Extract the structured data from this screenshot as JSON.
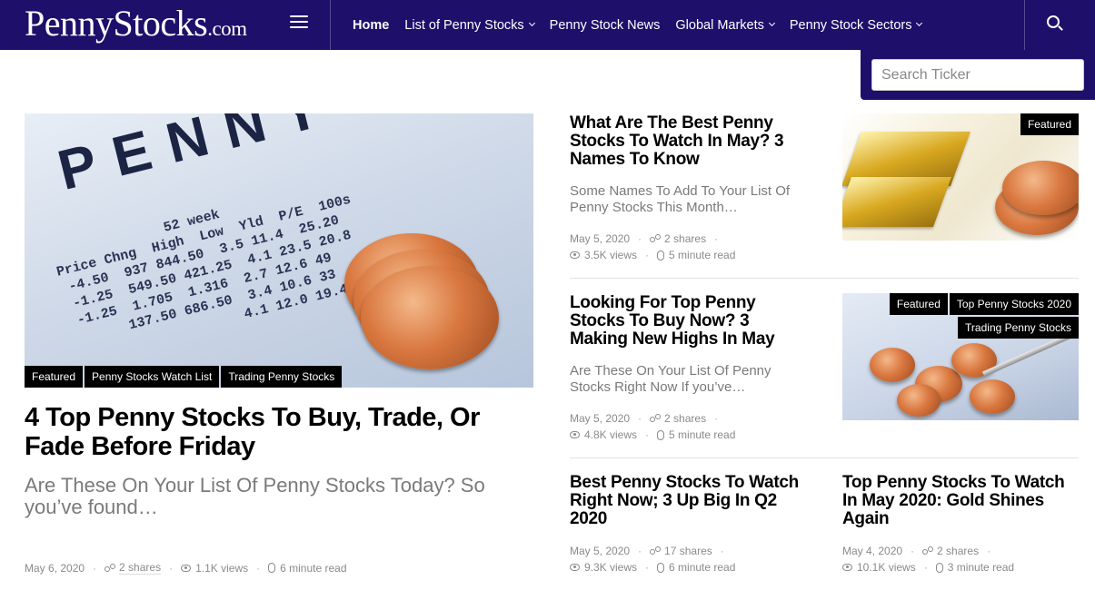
{
  "header": {
    "logo_main": "PennyStocks",
    "logo_domain": ".com",
    "nav": [
      "Home",
      "List of Penny Stocks",
      "Penny Stock News",
      "Global Markets",
      "Penny Stock Sectors"
    ],
    "search_placeholder": "Search Ticker",
    "colors": {
      "bar": "#1e0f6b",
      "text": "#ffffff"
    }
  },
  "hero": {
    "image_text": "PENNY STOCKS",
    "tags": [
      "Featured",
      "Penny Stocks Watch List",
      "Trading Penny Stocks"
    ],
    "title": "4 Top Penny Stocks To Buy, Trade, Or Fade Before Friday",
    "excerpt": "Are These On Your List Of Penny Stocks Today? So you’ve found…",
    "date": "May 6, 2020",
    "shares": "2 shares",
    "views": "1.1K views",
    "read": "6 minute read"
  },
  "cards": [
    {
      "title": "What Are The Best Penny Stocks To Watch In May? 3 Names To Know",
      "excerpt": "Some Names To Add To Your List Of Penny Stocks This Month…",
      "date": "May 5, 2020",
      "shares": "2 shares",
      "views": "3.5K views",
      "read": "5 minute read",
      "tags": [
        "Featured"
      ]
    },
    {
      "title": "Looking For Top Penny Stocks To Buy Now? 3 Making New Highs In May",
      "excerpt": "Are These On Your List Of Penny Stocks Right Now If you’ve…",
      "date": "May 5, 2020",
      "shares": "2 shares",
      "views": "4.8K views",
      "read": "5 minute read",
      "tags": [
        "Featured",
        "Top Penny Stocks 2020",
        "Trading Penny Stocks"
      ]
    },
    {
      "title": "Best Penny Stocks To Watch Right Now; 3 Up Big In Q2 2020",
      "date": "May 5, 2020",
      "shares": "17 shares",
      "views": "9.3K views",
      "read": "6 minute read"
    },
    {
      "title": "Top Penny Stocks To Watch In May 2020: Gold Shines Again",
      "date": "May 4, 2020",
      "shares": "2 shares",
      "views": "10.1K views",
      "read": "3 minute read"
    }
  ]
}
